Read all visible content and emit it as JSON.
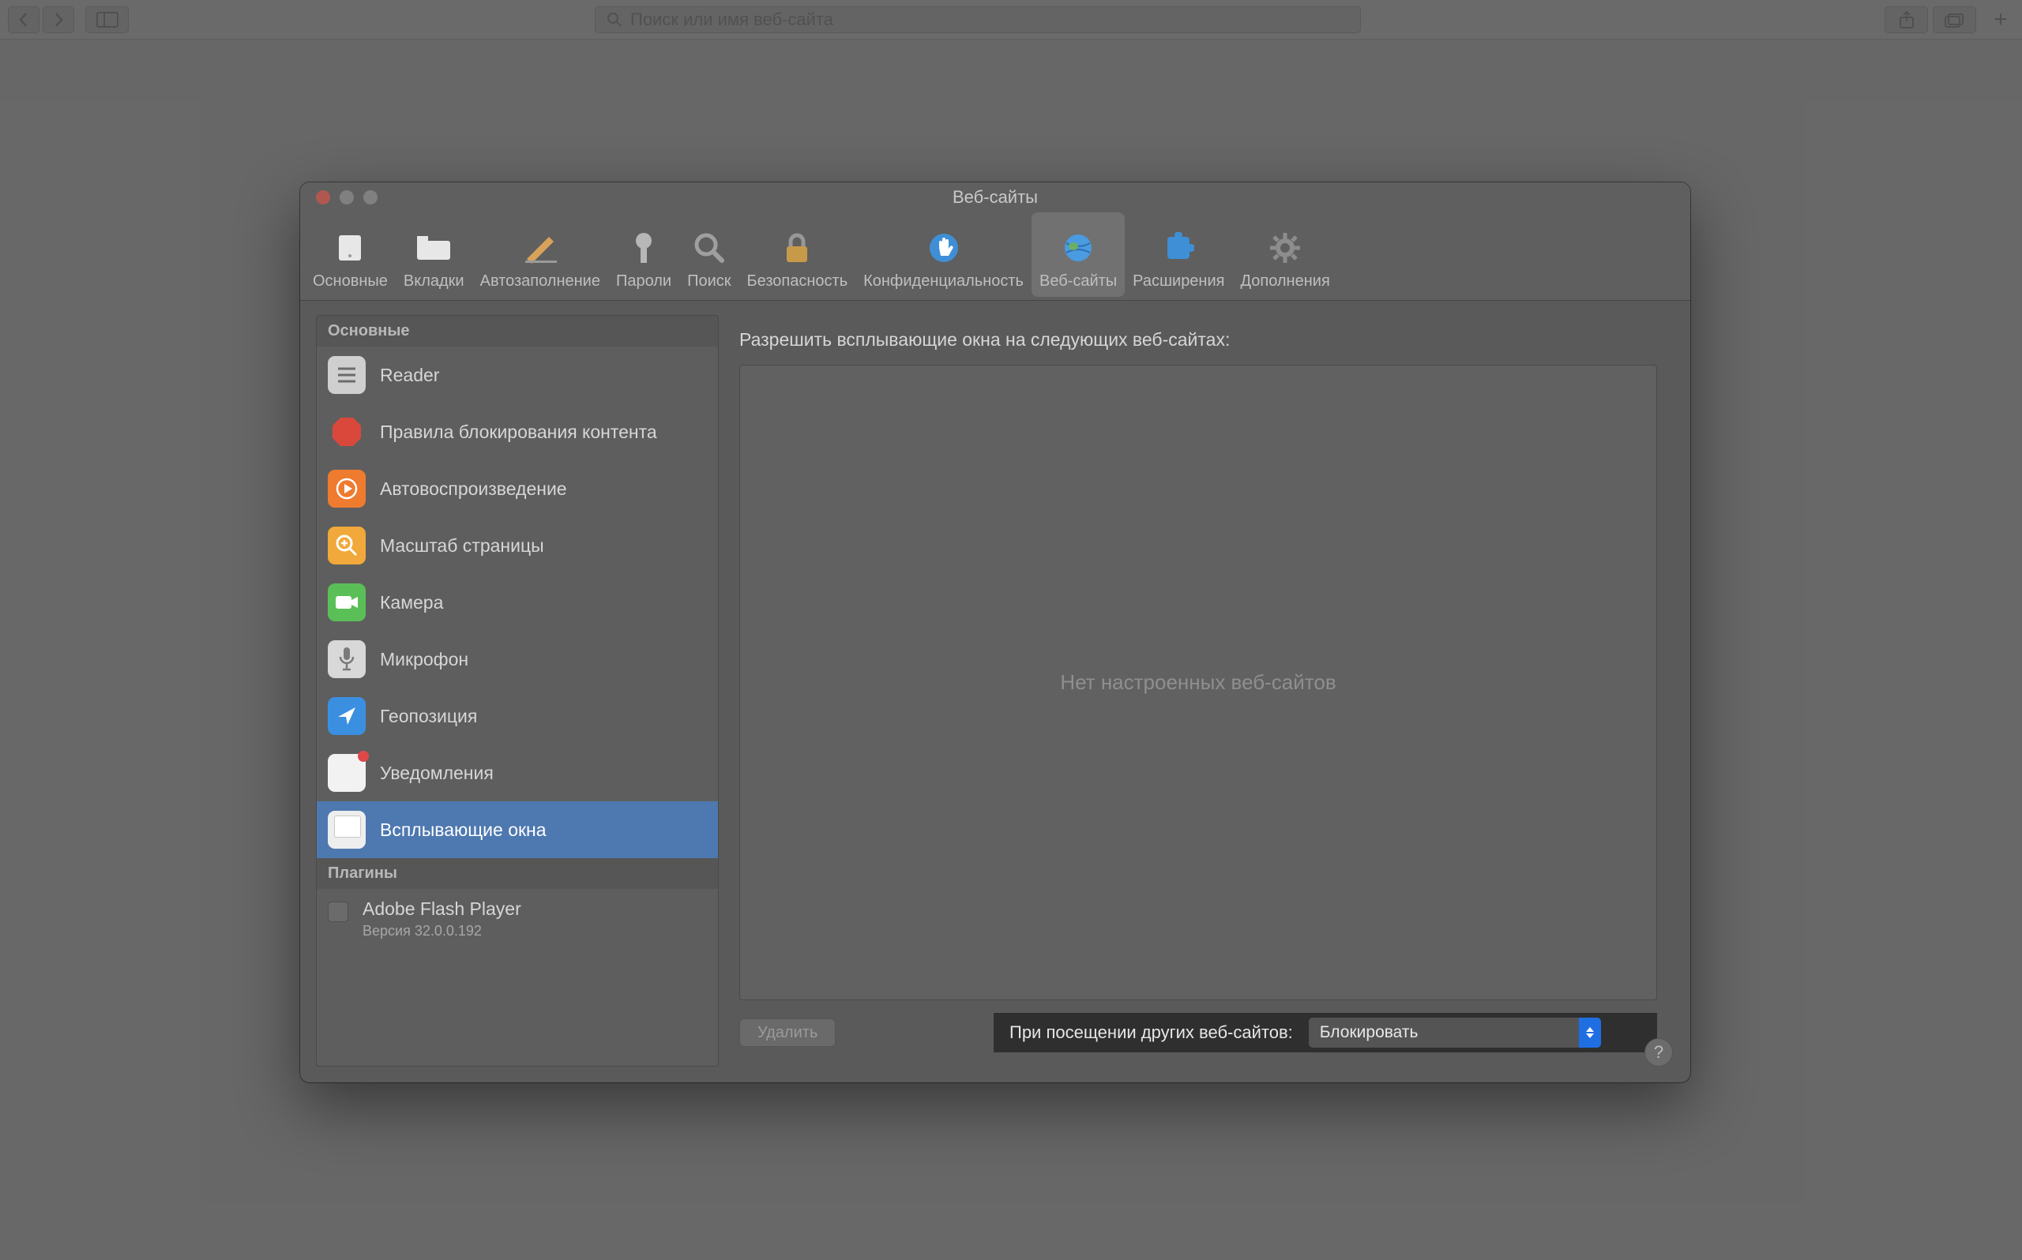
{
  "browser": {
    "search_placeholder": "Поиск или имя веб-сайта"
  },
  "prefs": {
    "title": "Веб-сайты",
    "tabs": [
      {
        "id": "general",
        "label": "Основные"
      },
      {
        "id": "tabs",
        "label": "Вкладки"
      },
      {
        "id": "autofill",
        "label": "Автозаполнение"
      },
      {
        "id": "passwords",
        "label": "Пароли"
      },
      {
        "id": "search",
        "label": "Поиск"
      },
      {
        "id": "security",
        "label": "Безопасность"
      },
      {
        "id": "privacy",
        "label": "Конфиденциальность"
      },
      {
        "id": "websites",
        "label": "Веб-сайты"
      },
      {
        "id": "extensions",
        "label": "Расширения"
      },
      {
        "id": "advanced",
        "label": "Дополнения"
      }
    ],
    "active_tab": "websites",
    "sidebar": {
      "section_main": "Основные",
      "section_plugins": "Плагины",
      "items": [
        {
          "id": "reader",
          "label": "Reader"
        },
        {
          "id": "blockers",
          "label": "Правила блокирования контента"
        },
        {
          "id": "autoplay",
          "label": "Автовоспроизведение"
        },
        {
          "id": "zoom",
          "label": "Масштаб страницы"
        },
        {
          "id": "camera",
          "label": "Камера"
        },
        {
          "id": "microphone",
          "label": "Микрофон"
        },
        {
          "id": "location",
          "label": "Геопозиция"
        },
        {
          "id": "notifications",
          "label": "Уведомления"
        },
        {
          "id": "popups",
          "label": "Всплывающие окна"
        }
      ],
      "selected": "popups",
      "plugin": {
        "name": "Adobe Flash Player",
        "version": "Версия 32.0.0.192",
        "enabled": false
      }
    },
    "main": {
      "heading": "Разрешить всплывающие окна на следующих веб-сайтах:",
      "empty_text": "Нет настроенных веб-сайтов",
      "delete_label": "Удалить",
      "policy_label": "При посещении других веб-сайтов:",
      "policy_value": "Блокировать"
    },
    "help_tooltip": "?"
  }
}
